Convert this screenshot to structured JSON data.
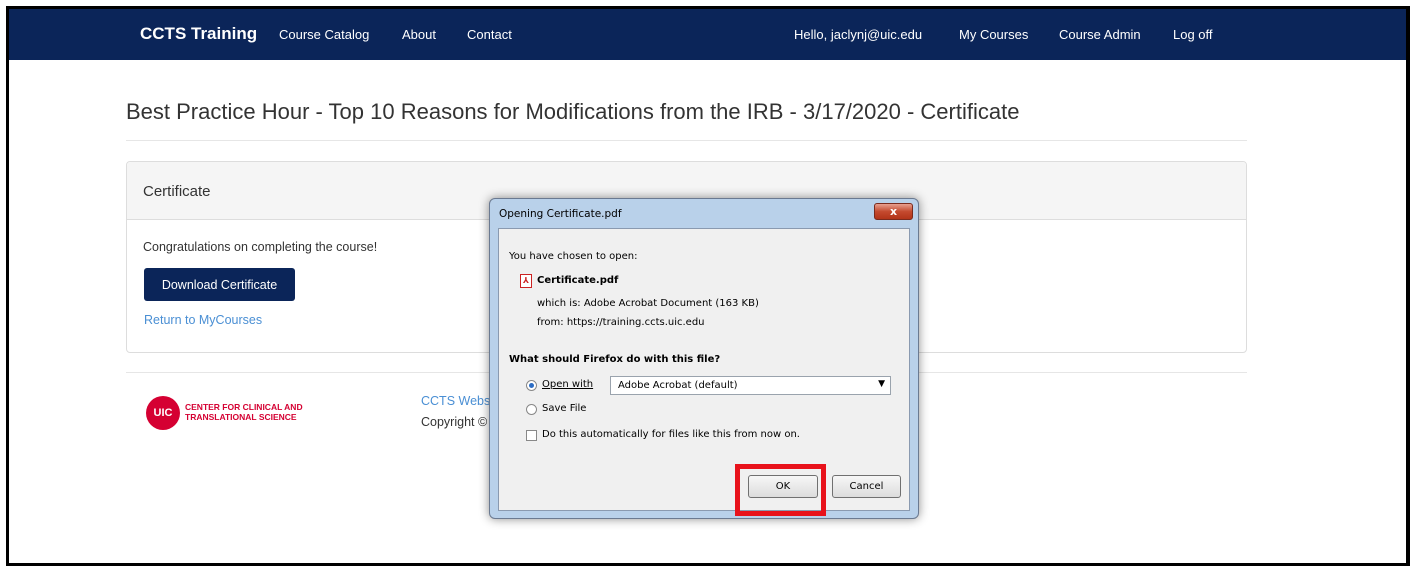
{
  "navbar": {
    "brand": "CCTS Training",
    "links": [
      "Course Catalog",
      "About",
      "Contact"
    ],
    "greeting": "Hello, jaclynj@uic.edu",
    "right_links": [
      "My Courses",
      "Course Admin",
      "Log off"
    ]
  },
  "page": {
    "title": "Best Practice Hour - Top 10 Reasons for Modifications from the IRB - 3/17/2020 - Certificate"
  },
  "panel": {
    "heading": "Certificate",
    "message": "Congratulations on completing the course!",
    "download_label": "Download Certificate",
    "return_link": "Return to MyCourses"
  },
  "footer": {
    "logo_mark": "UIC",
    "logo_line1": "CENTER FOR CLINICAL AND",
    "logo_line2": "TRANSLATIONAL SCIENCE",
    "link_partial": "CCTS Webs",
    "copyright_partial": "Copyright ©"
  },
  "dialog": {
    "title": "Opening Certificate.pdf",
    "close_label": "x",
    "chosen_label": "You have chosen to open:",
    "file_name": "Certificate.pdf",
    "which_is": "which is:  Adobe Acrobat Document (163 KB)",
    "from": "from:  https://training.ccts.uic.edu",
    "question": "What should Firefox do with this file?",
    "open_with_label": "Open with",
    "open_with_value": "Adobe Acrobat  (default)",
    "save_file_label": "Save File",
    "auto_label": "Do this automatically for files like this from now on.",
    "ok_label": "OK",
    "cancel_label": "Cancel"
  },
  "colors": {
    "navbar": "#0b2559",
    "link": "#4a8fd4",
    "highlight": "#e8121b",
    "uic_red": "#d50032"
  }
}
